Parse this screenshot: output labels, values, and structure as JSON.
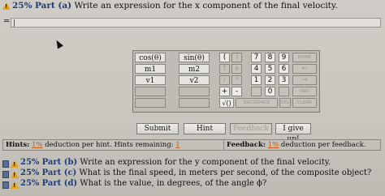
{
  "part_a": {
    "percent": "25%",
    "part_label": "Part (a)",
    "question": "Write an expression for the x component of the final velocity."
  },
  "answer": {
    "prefix": "="
  },
  "palette": {
    "symbols": [
      [
        "cos(θ)",
        "sin(θ)"
      ],
      [
        "m1",
        "m2"
      ],
      [
        "v1",
        "v2"
      ],
      [
        "",
        ""
      ],
      [
        "",
        ""
      ]
    ],
    "keys": {
      "row1": [
        "(",
        ")",
        "7",
        "8",
        "9"
      ],
      "row2": [
        "↑",
        "∧",
        "4",
        "5",
        "6"
      ],
      "row3": [
        "/",
        "*",
        "1",
        "2",
        "3"
      ],
      "row4": [
        "+",
        "-",
        "0",
        "."
      ],
      "sqrt": "√()",
      "home": "HOME",
      "left": "←",
      "right": "→",
      "end": "END",
      "backspace": "BACKSPACE",
      "del": "DEL",
      "clear": "CLEAR"
    }
  },
  "buttons": {
    "submit": "Submit",
    "hint": "Hint",
    "feedback": "Feedback",
    "give_up": "I give up!"
  },
  "hints": {
    "label": "Hints:",
    "pct": "1%",
    "text": "deduction per hint. Hints remaining:",
    "remaining": "1"
  },
  "feedback": {
    "label": "Feedback:",
    "pct": "1%",
    "text": "deduction per feedback."
  },
  "other_parts": [
    {
      "percent": "25%",
      "label": "Part (b)",
      "question": "Write an expression for the y component of the final velocity."
    },
    {
      "percent": "25%",
      "label": "Part (c)",
      "question": "What is the final speed, in meters per second, of the composite object?"
    },
    {
      "percent": "25%",
      "label": "Part (d)",
      "question": "What is the value, in degrees, of the angle ϕ?"
    }
  ]
}
